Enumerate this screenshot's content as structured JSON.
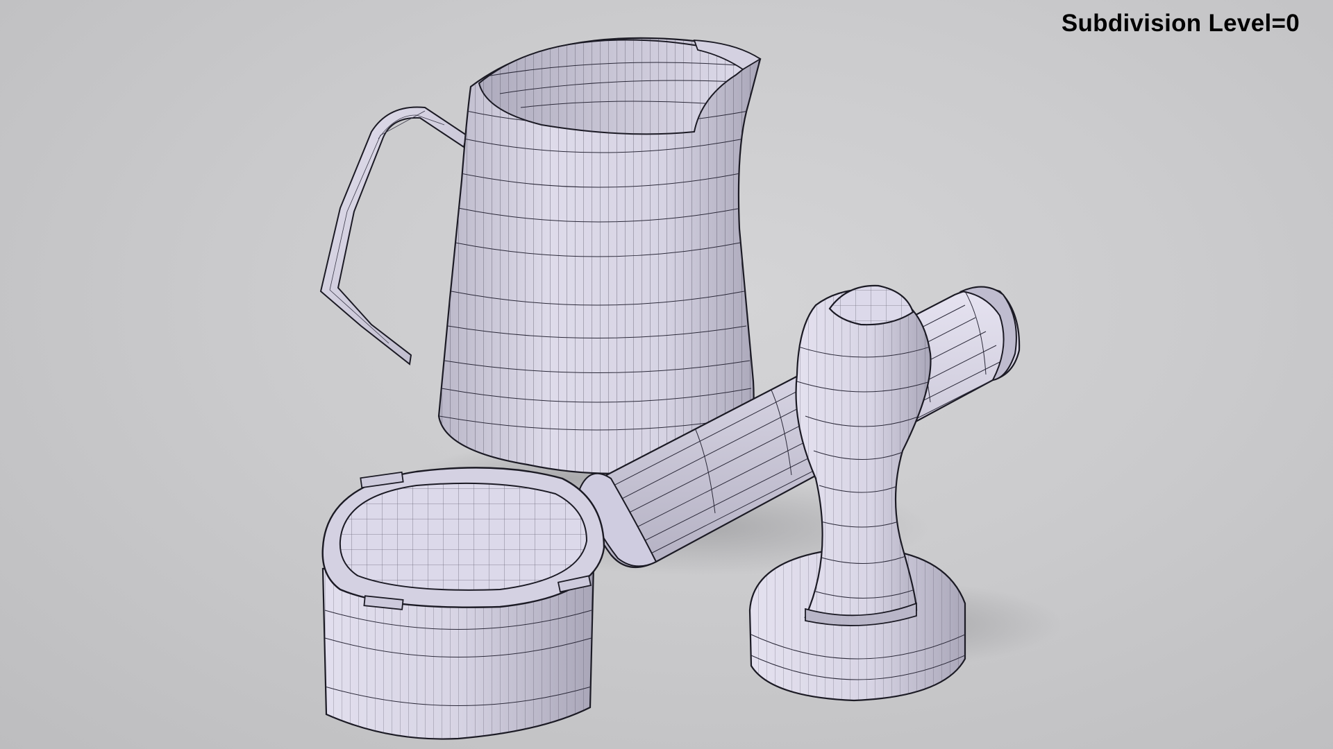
{
  "viewport": {
    "overlay_label": "Subdivision Level=0",
    "background_color": "#c9c9cb",
    "mesh_color": "#d9d6e6",
    "wire_color": "#2a2838"
  },
  "objects": [
    {
      "name": "milk-pitcher"
    },
    {
      "name": "portafilter"
    },
    {
      "name": "coffee-tamper"
    }
  ]
}
